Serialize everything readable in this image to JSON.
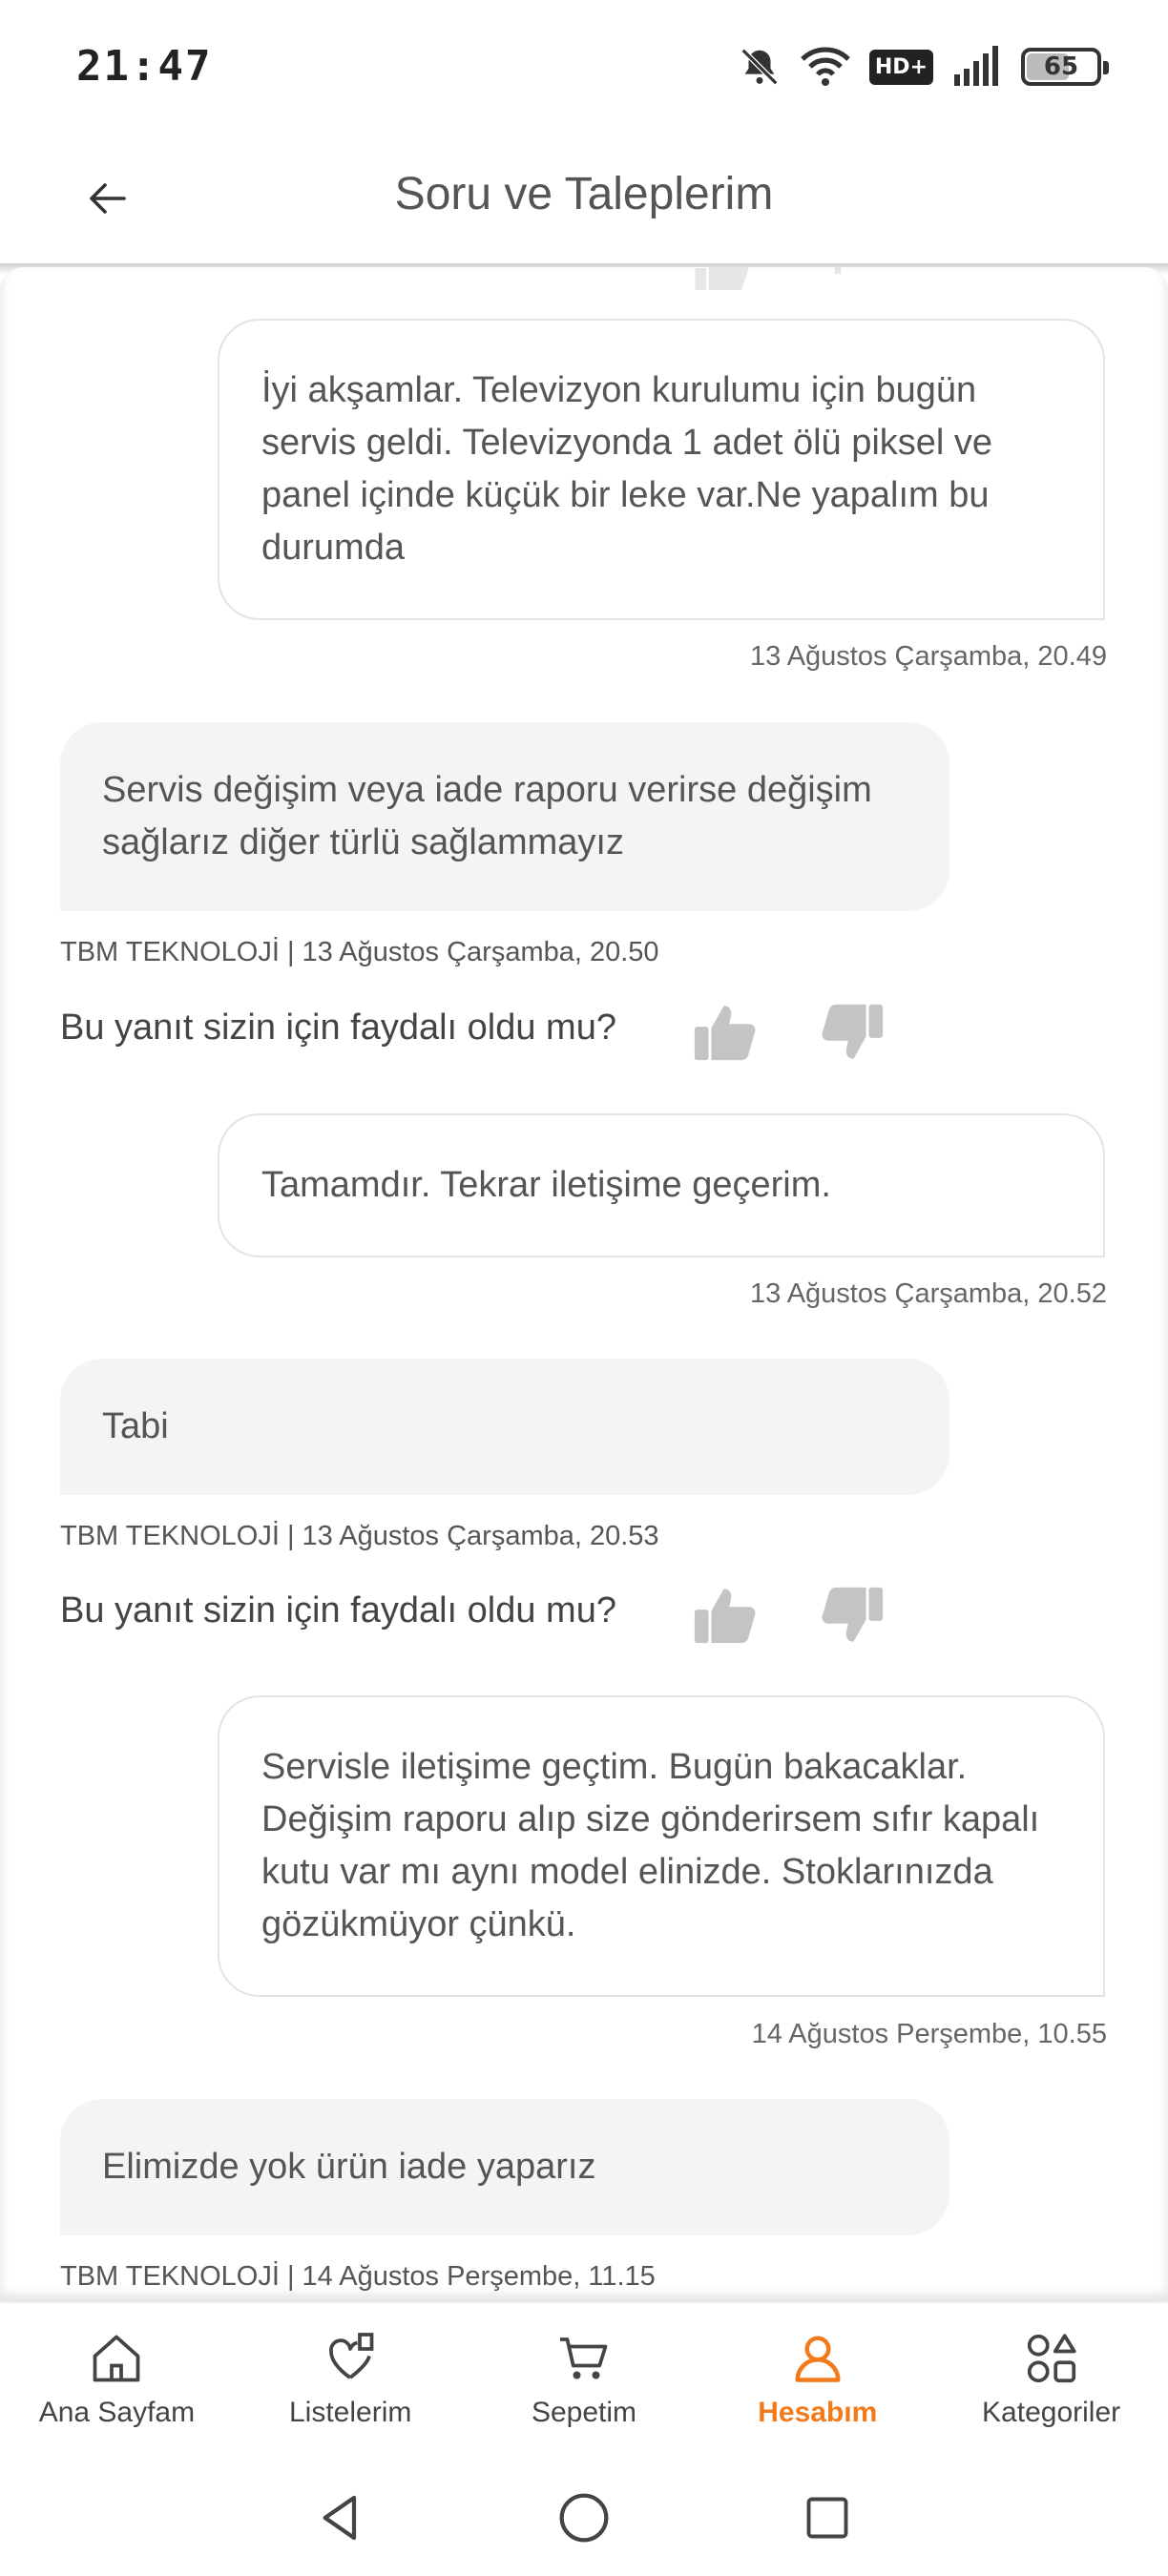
{
  "status_bar": {
    "time": "21:47",
    "hd_label": "HD+",
    "battery": "65",
    "battery_level_percent": 65
  },
  "header": {
    "title": "Soru ve Taleplerim",
    "back_icon": "arrow-left-icon"
  },
  "messages": [
    {
      "type": "user",
      "text": "İyi akşamlar. Televizyon kurulumu için bugün servis geldi. Televizyonda 1 adet ölü piksel ve panel içinde küçük bir leke var.Ne yapalım bu durumda",
      "timestamp": "13 Ağustos Çarşamba, 20.49"
    },
    {
      "type": "seller",
      "text": "Servis değişim veya iade raporu verirse değişim sağlarız diğer türlü sağlammayız",
      "meta": "TBM TEKNOLOJİ | 13 Ağustos Çarşamba, 20.50",
      "feedback_question": "Bu yanıt sizin için faydalı oldu mu?"
    },
    {
      "type": "user",
      "text": "Tamamdır. Tekrar iletişime geçerim.",
      "timestamp": "13 Ağustos Çarşamba, 20.52"
    },
    {
      "type": "seller",
      "text": "Tabi",
      "meta": "TBM TEKNOLOJİ | 13 Ağustos Çarşamba, 20.53",
      "feedback_question": "Bu yanıt sizin için faydalı oldu mu?"
    },
    {
      "type": "user",
      "text": "Servisle iletişime geçtim. Bugün bakacaklar. Değişim raporu alıp size gönderirsem sıfır kapalı kutu var mı aynı model elinizde. Stoklarınızda gözükmüyor çünkü.",
      "timestamp": "14 Ağustos Perşembe, 10.55"
    },
    {
      "type": "seller",
      "text": "Elimizde yok ürün iade yaparız",
      "meta": "TBM TEKNOLOJİ | 14 Ağustos Perşembe, 11.15"
    }
  ],
  "bottom_nav": [
    {
      "label": "Ana Sayfam",
      "icon": "home-icon",
      "active": false
    },
    {
      "label": "Listelerim",
      "icon": "heart-list-icon",
      "active": false
    },
    {
      "label": "Sepetim",
      "icon": "cart-icon",
      "active": false
    },
    {
      "label": "Hesabım",
      "icon": "user-icon",
      "active": true
    },
    {
      "label": "Kategoriler",
      "icon": "categories-icon",
      "active": false
    }
  ],
  "colors": {
    "accent": "#f27a1a",
    "bubble_seller": "#f4f4f4",
    "text": "#555555"
  }
}
